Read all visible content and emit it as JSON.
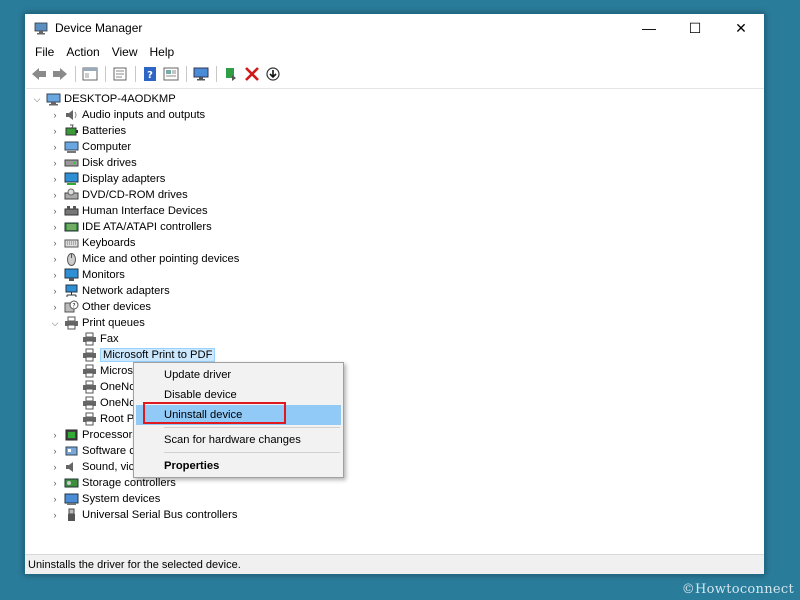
{
  "window": {
    "title": "Device Manager",
    "controls": {
      "minimize": "—",
      "maximize": "☐",
      "close": "✕"
    }
  },
  "menubar": {
    "items": [
      "File",
      "Action",
      "View",
      "Help"
    ]
  },
  "toolbar": {
    "buttons": [
      "back-icon",
      "forward-icon",
      "show-hide-icon",
      "properties-icon",
      "help-icon",
      "view-icon",
      "monitor-scan-icon",
      "enable-device-icon",
      "uninstall-icon",
      "update-driver-icon"
    ]
  },
  "tree": {
    "root": "DESKTOP-4AODKMP",
    "categories": [
      {
        "label": "Audio inputs and outputs",
        "expanded": false
      },
      {
        "label": "Batteries",
        "expanded": false
      },
      {
        "label": "Computer",
        "expanded": false
      },
      {
        "label": "Disk drives",
        "expanded": false
      },
      {
        "label": "Display adapters",
        "expanded": false
      },
      {
        "label": "DVD/CD-ROM drives",
        "expanded": false
      },
      {
        "label": "Human Interface Devices",
        "expanded": false
      },
      {
        "label": "IDE ATA/ATAPI controllers",
        "expanded": false
      },
      {
        "label": "Keyboards",
        "expanded": false
      },
      {
        "label": "Mice and other pointing devices",
        "expanded": false
      },
      {
        "label": "Monitors",
        "expanded": false
      },
      {
        "label": "Network adapters",
        "expanded": false
      },
      {
        "label": "Other devices",
        "expanded": false
      },
      {
        "label": "Print queues",
        "expanded": true
      },
      {
        "label": "Processors",
        "expanded": false
      },
      {
        "label": "Software c",
        "expanded": false
      },
      {
        "label": "Sound, vic",
        "expanded": false
      },
      {
        "label": "Storage controllers",
        "expanded": false
      },
      {
        "label": "System devices",
        "expanded": false
      },
      {
        "label": "Universal Serial Bus controllers",
        "expanded": false
      }
    ],
    "print_queue_children": [
      {
        "label": "Fax",
        "selected": false
      },
      {
        "label": "Microsoft Print to PDF",
        "selected": true
      },
      {
        "label": "Micros",
        "selected": false
      },
      {
        "label": "OneNo",
        "selected": false
      },
      {
        "label": "OneNo",
        "selected": false
      },
      {
        "label": "Root P",
        "selected": false
      }
    ]
  },
  "context_menu": {
    "items": [
      {
        "label": "Update driver",
        "hovered": false,
        "bold": false
      },
      {
        "label": "Disable device",
        "hovered": false,
        "bold": false
      },
      {
        "label": "Uninstall device",
        "hovered": true,
        "bold": false
      },
      {
        "label": "Scan for hardware changes",
        "hovered": false,
        "bold": false
      },
      {
        "label": "Properties",
        "hovered": false,
        "bold": true
      }
    ]
  },
  "statusbar": {
    "text": "Uninstalls the driver for the selected device."
  },
  "watermark": "©Howtoconnect",
  "colors": {
    "desktop": "#2a7c9b",
    "menu_hover": "#91c9f7",
    "selection": "#cce8ff",
    "highlight": "#e0191f"
  }
}
